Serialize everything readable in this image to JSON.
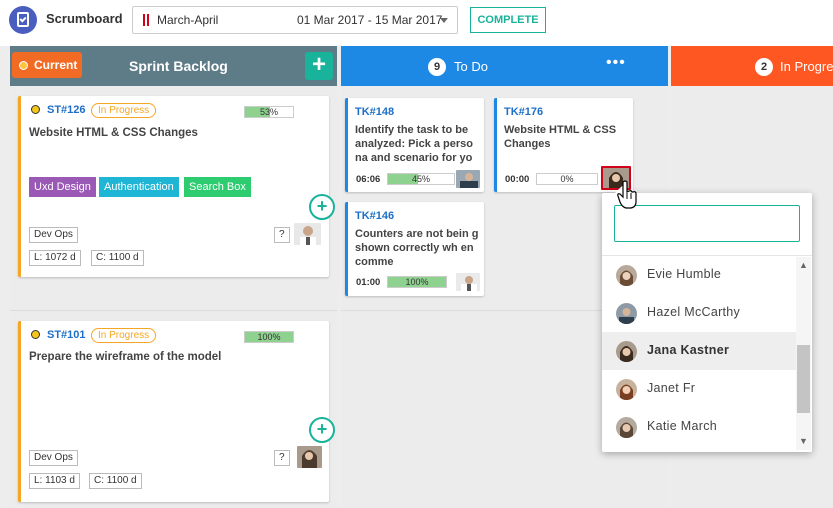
{
  "app": {
    "title": "Scrumboard"
  },
  "sprint": {
    "name": "March-April",
    "range": "01 Mar 2017 - 15 Mar 2017",
    "complete_label": "COMPLETE"
  },
  "backlog": {
    "current_label": "Current",
    "title": "Sprint Backlog",
    "add_icon": "+"
  },
  "todo": {
    "count": "9",
    "title": "To Do",
    "more_icon": "•••"
  },
  "inprogress": {
    "count": "2",
    "title": "In Progre"
  },
  "stories": [
    {
      "id": "ST#126",
      "status": "In Progress",
      "progress": "53%",
      "progress_value": 53,
      "title": "Website HTML & CSS Changes",
      "tags": [
        "Uxd Design",
        "Authentication",
        "Search Box"
      ],
      "team": "Dev Ops",
      "help": "?",
      "l": "L: 1072 d",
      "c": "C: 1100 d"
    },
    {
      "id": "ST#101",
      "status": "In Progress",
      "progress": "100%",
      "progress_value": 100,
      "title": "Prepare the wireframe of the model",
      "tags": [],
      "team": "Dev Ops",
      "help": "?",
      "l": "L: 1103 d",
      "c": "C: 1100 d"
    }
  ],
  "tasks": [
    {
      "id": "TK#148",
      "title": "Identify the task to be analyzed: Pick a perso na and scenario for yo",
      "time": "06:06",
      "progress": "45%",
      "progress_value": 45
    },
    {
      "id": "TK#146",
      "title": "Counters are not bein g shown correctly wh en comme",
      "time": "01:00",
      "progress": "100%",
      "progress_value": 100
    },
    {
      "id": "TK#176",
      "title": "Website HTML & CSS Changes",
      "time": "00:00",
      "progress": "0%",
      "progress_value": 0
    }
  ],
  "assign_popup": {
    "search_value": "",
    "members": [
      {
        "name": "Evie Humble",
        "highlighted": false
      },
      {
        "name": "Hazel McCarthy",
        "highlighted": false
      },
      {
        "name": "Jana Kastner",
        "highlighted": true
      },
      {
        "name": "Janet Fr",
        "highlighted": false
      },
      {
        "name": "Katie March",
        "highlighted": false
      }
    ]
  },
  "colors": {
    "accent": "#19b39b",
    "todo": "#1e88e5",
    "inprogress": "#ff5722",
    "backlog": "#5e7b88",
    "current": "#f26b24",
    "story_border": "#f5a623"
  }
}
